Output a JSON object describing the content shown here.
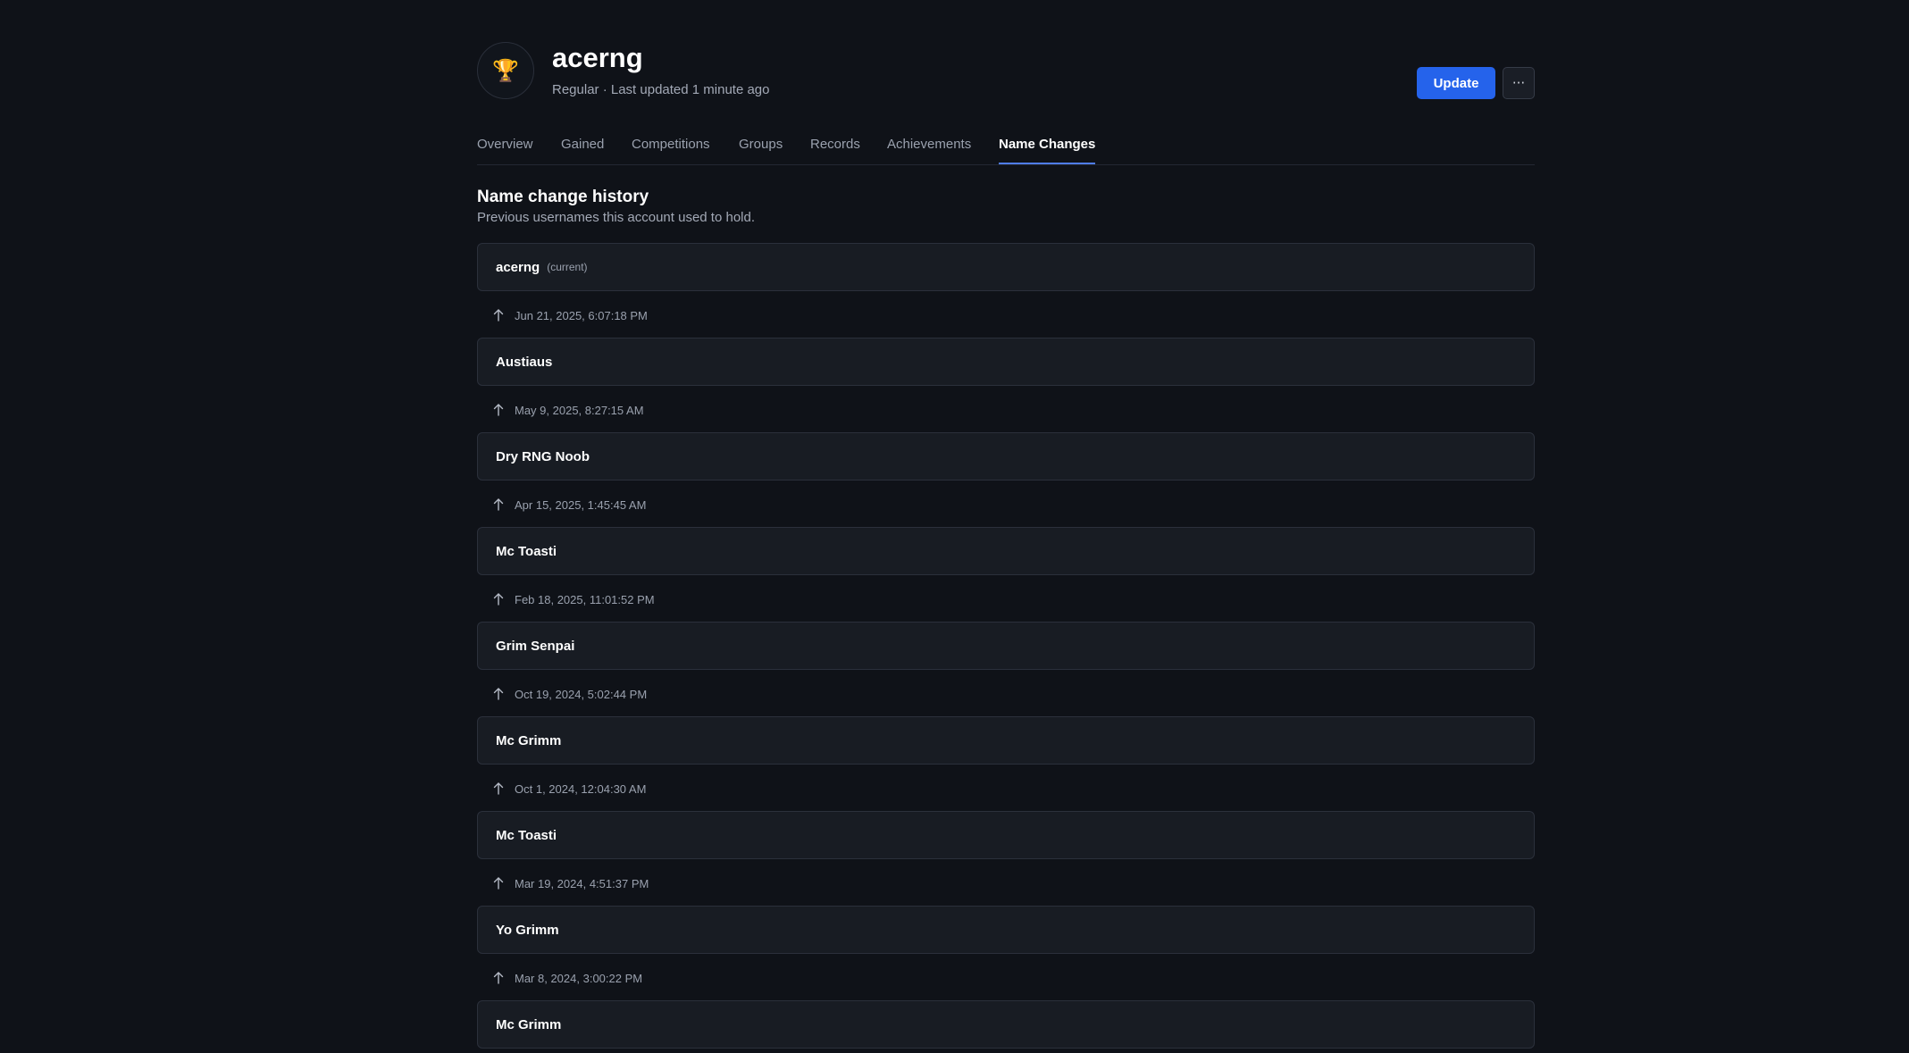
{
  "player": {
    "name": "acerng",
    "meta": "Regular · Last updated 1 minute ago",
    "avatar_icon": "trophy-icon"
  },
  "actions": {
    "update_label": "Update",
    "more_label": "···"
  },
  "tabs": [
    {
      "label": "Overview",
      "active": false
    },
    {
      "label": "Gained",
      "active": false
    },
    {
      "label": "Competitions",
      "active": false
    },
    {
      "label": "Groups",
      "active": false
    },
    {
      "label": "Records",
      "active": false
    },
    {
      "label": "Achievements",
      "active": false
    },
    {
      "label": "Name Changes",
      "active": true
    }
  ],
  "section": {
    "title": "Name change history",
    "subtitle": "Previous usernames this account used to hold."
  },
  "history": {
    "current_tag": "(current)",
    "names": [
      "acerng",
      "Austiaus",
      "Dry RNG Noob",
      "Mc Toasti",
      "Grim Senpai",
      "Mc Grimm",
      "Mc Toasti",
      "Yo Grimm",
      "Mc Grimm"
    ],
    "dates": [
      "Jun 21, 2025, 6:07:18 PM",
      "May 9, 2025, 8:27:15 AM",
      "Apr 15, 2025, 1:45:45 AM",
      "Feb 18, 2025, 11:01:52 PM",
      "Oct 19, 2024, 5:02:44 PM",
      "Oct 1, 2024, 12:04:30 AM",
      "Mar 19, 2024, 4:51:37 PM",
      "Mar 8, 2024, 3:00:22 PM"
    ]
  },
  "colors": {
    "background": "#0f1218",
    "card": "#181c23",
    "accent": "#2563eb",
    "tab_underline": "#4f7de8"
  }
}
